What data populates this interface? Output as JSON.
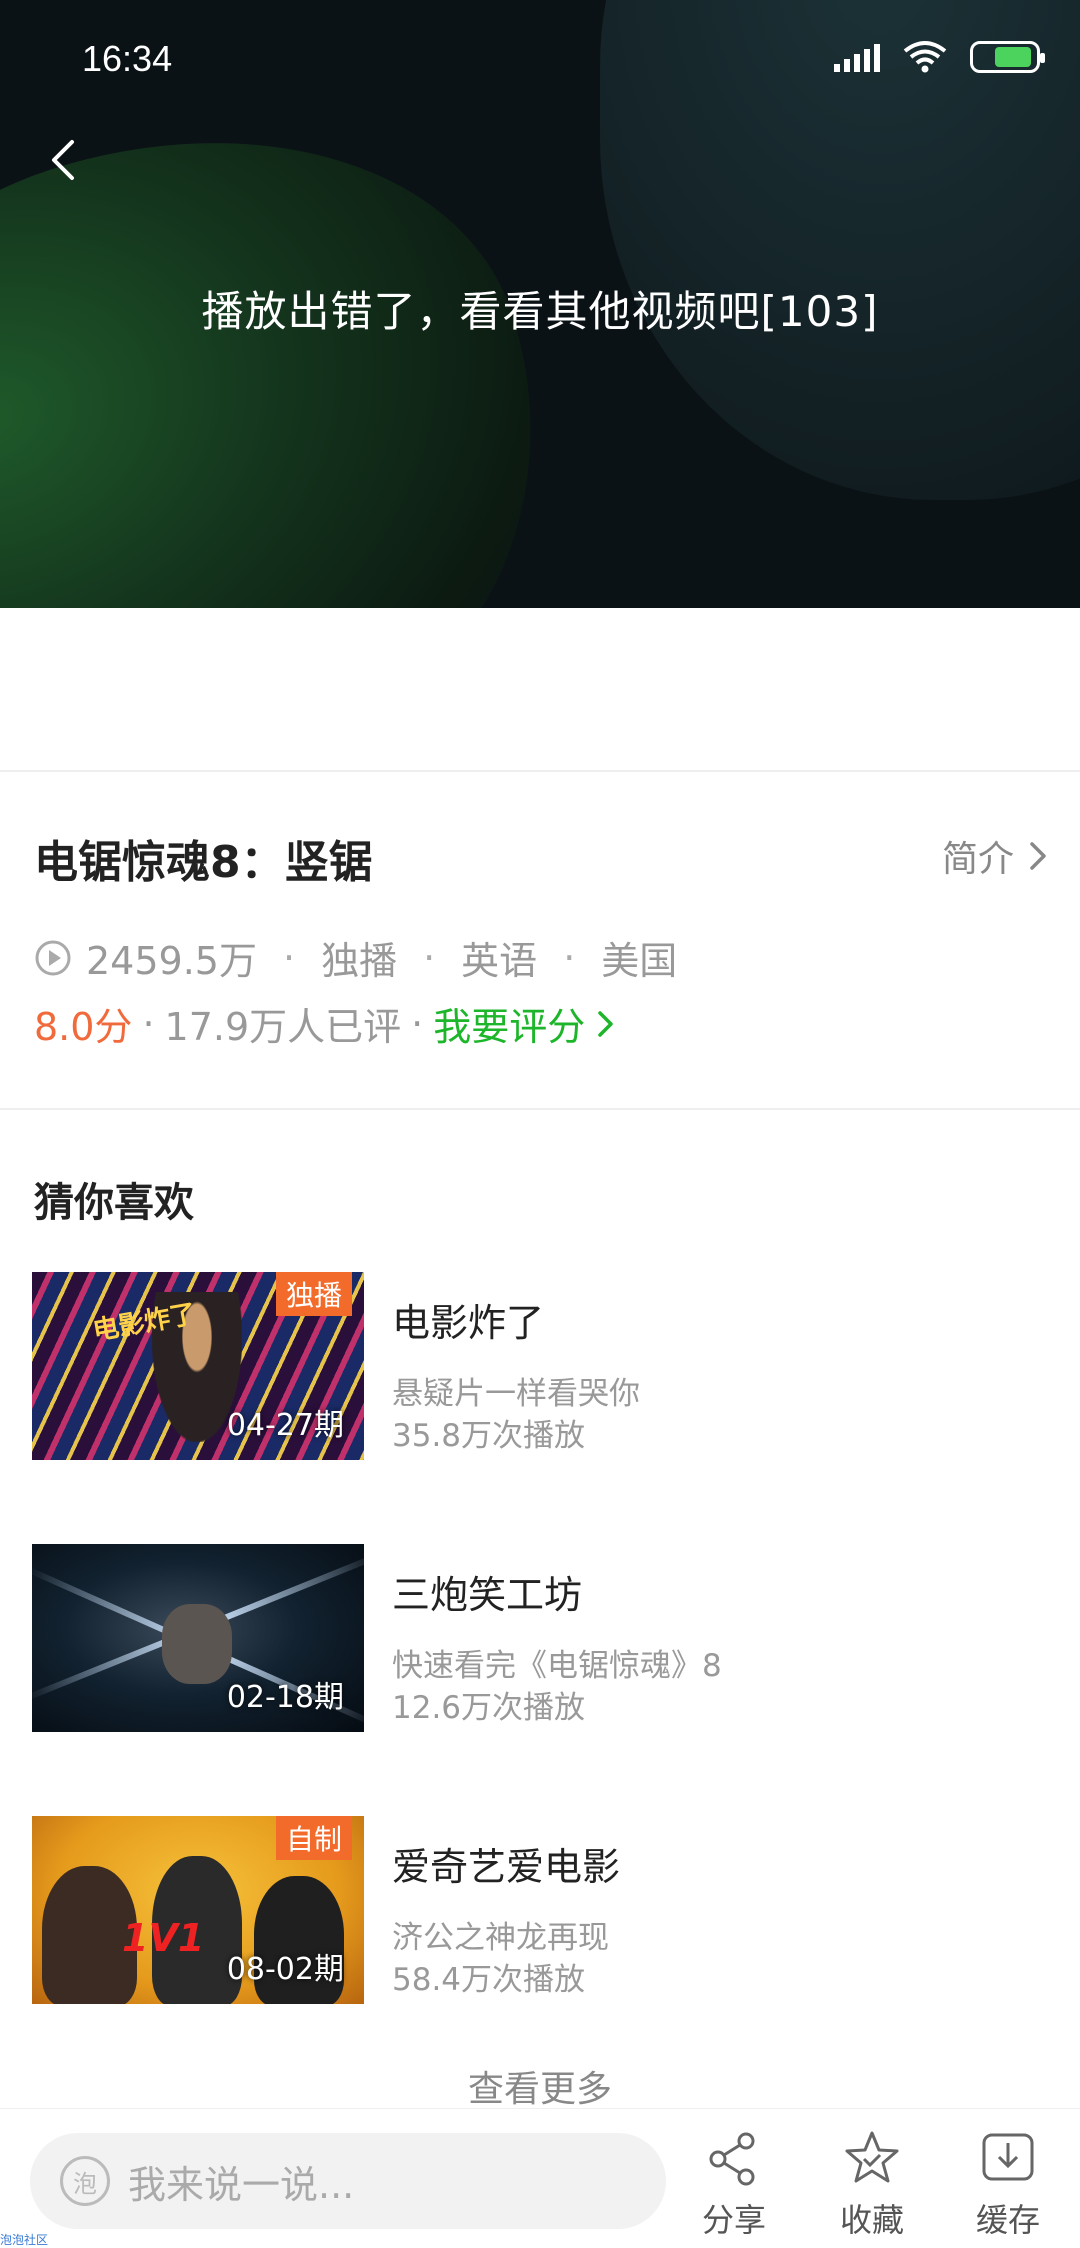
{
  "status": {
    "time": "16:34"
  },
  "player": {
    "error_message": "播放出错了，看看其他视频吧[103]"
  },
  "info": {
    "title": "电锯惊魂8：竖锯",
    "intro_label": "简介",
    "plays": "2459.5万",
    "tags": [
      "独播",
      "英语",
      "美国"
    ],
    "score": "8.0分",
    "raters": "17.9万人已评",
    "rate_label": "我要评分"
  },
  "recommend": {
    "section_title": "猜你喜欢",
    "items": [
      {
        "title": "电影炸了",
        "desc": "悬疑片一样看哭你",
        "plays": "35.8万次播放",
        "episode": "04-27期",
        "badge": "独播"
      },
      {
        "title": "三炮笑工坊",
        "desc": "快速看完《电锯惊魂》8",
        "plays": "12.6万次播放",
        "episode": "02-18期",
        "badge": ""
      },
      {
        "title": "爱奇艺爱电影",
        "desc": "济公之神龙再现",
        "plays": "58.4万次播放",
        "episode": "08-02期",
        "badge": "自制"
      }
    ],
    "see_more": "查看更多"
  },
  "bottom_bar": {
    "comment_placeholder": "我来说一说...",
    "comment_icon_text": "泡",
    "share_label": "分享",
    "favorite_label": "收藏",
    "download_label": "缓存",
    "footer_text": "泡泡社区"
  },
  "colors": {
    "score": "#f06a3c",
    "rate_link": "#1db52a",
    "badge": "#f36b2a"
  }
}
